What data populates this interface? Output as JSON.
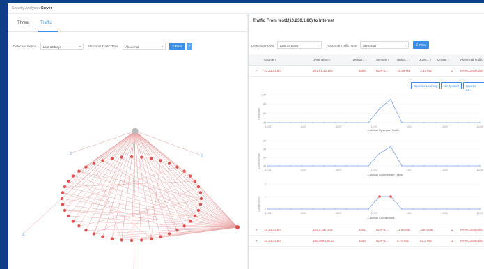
{
  "breadcrumb": {
    "parent": "Security Analysis",
    "sep": " / ",
    "current": "Server"
  },
  "left_tabs": [
    {
      "label": "Threat"
    },
    {
      "label": "Traffic"
    }
  ],
  "filters_left": {
    "detection_label": "Detection Period",
    "detection_value": "Last 14 Days",
    "abnormal_label": "Abnormal Traffic Type",
    "abnormal_value": "Abnormal",
    "filter_label": "Filter",
    "extra_label": "+"
  },
  "right_panel": {
    "title": "Traffic From test1(10.230.1.80) to Internet",
    "filters": {
      "detection_label": "Detection Period",
      "detection_value": "Last 14 Days",
      "abnormal_label": "Abnormal Traffic Type",
      "abnormal_value": "Abnormal",
      "filter_label": "Filter"
    },
    "columns": [
      "Source ↕",
      "Destination ↕",
      "Destin... ↕",
      "Service ↕",
      "Uploa... ↕",
      "Down... ↕",
      "Conne... ↕",
      "Abnormal Traffic"
    ],
    "rows": [
      {
        "toggle": "−",
        "source": "10.230.1.80",
        "destination": "101.91.22.103",
        "port": "8080",
        "service": "UDP-4...",
        "upload": "16.29 MB",
        "download": "3.32 MB",
        "connections": "2",
        "abnormal": "New Connection"
      },
      {
        "toggle": "+",
        "source": "10.230.1.80",
        "destination": "153.3.247.214",
        "port": "8081",
        "service": "UDP-4...",
        "upload": "11.84 MB",
        "download": "116.4 MB",
        "connections": "2",
        "abnormal": "New Connection"
      },
      {
        "toggle": "+",
        "source": "10.230.1.80",
        "destination": "180.169.150.31",
        "port": "8083",
        "service": "UDP-4...",
        "upload": "6.78 MB",
        "download": "82.2 MB",
        "connections": "3",
        "abnormal": "New Connection"
      }
    ],
    "actions": [
      "Baseline Learning",
      "Not Monitor",
      "Ignored Ev..."
    ]
  },
  "chart_data": [
    {
      "type": "line",
      "ylabel": "Upstream",
      "legend": "Actual Upstream Traffic",
      "x": [
        "11/23",
        "11/25",
        "11/27",
        "11/29",
        "12/01",
        "12/03",
        "12/05"
      ],
      "yticks": [
        "12M",
        "8M",
        "4M",
        "0M"
      ],
      "ylim": [
        0,
        12
      ],
      "series": [
        {
          "name": "Actual Upstream Traffic",
          "values": [
            0,
            0,
            0,
            0,
            0,
            0,
            0,
            0,
            0,
            0,
            6,
            10,
            0,
            0,
            0,
            0,
            0,
            0,
            0,
            0
          ]
        }
      ]
    },
    {
      "type": "line",
      "ylabel": "Downstream",
      "legend": "Actual Downstream Traffic",
      "x": [
        "11/23",
        "11/25",
        "11/27",
        "11/29",
        "12/01",
        "12/03",
        "12/05"
      ],
      "yticks": [
        "3M",
        "2M",
        "1M",
        "0M"
      ],
      "ylim": [
        0,
        3
      ],
      "series": [
        {
          "name": "Actual Downstream Traffic",
          "values": [
            0,
            0,
            0,
            0,
            0,
            0,
            0,
            0,
            0,
            0,
            1.5,
            2.3,
            0,
            0,
            0,
            0,
            0,
            0,
            0,
            0
          ]
        }
      ]
    },
    {
      "type": "line",
      "ylabel": "Connections",
      "legend": "Actual Connections",
      "x": [
        "11/23",
        "11/25",
        "11/27",
        "11/29",
        "12/01",
        "12/03",
        "12/05"
      ],
      "yticks": [
        "2",
        "1",
        "0"
      ],
      "ylim": [
        0,
        2
      ],
      "series": [
        {
          "name": "Actual Connections",
          "values": [
            0,
            0,
            0,
            0,
            0,
            0,
            0,
            0,
            0,
            0,
            1,
            1,
            0,
            0,
            0,
            0,
            0,
            0,
            0,
            0
          ]
        }
      ]
    }
  ],
  "colors": {
    "accent": "#3a8ee6",
    "alert": "#e05252",
    "edge": "#e8a0a0",
    "header_bg": "#0e3f86"
  }
}
